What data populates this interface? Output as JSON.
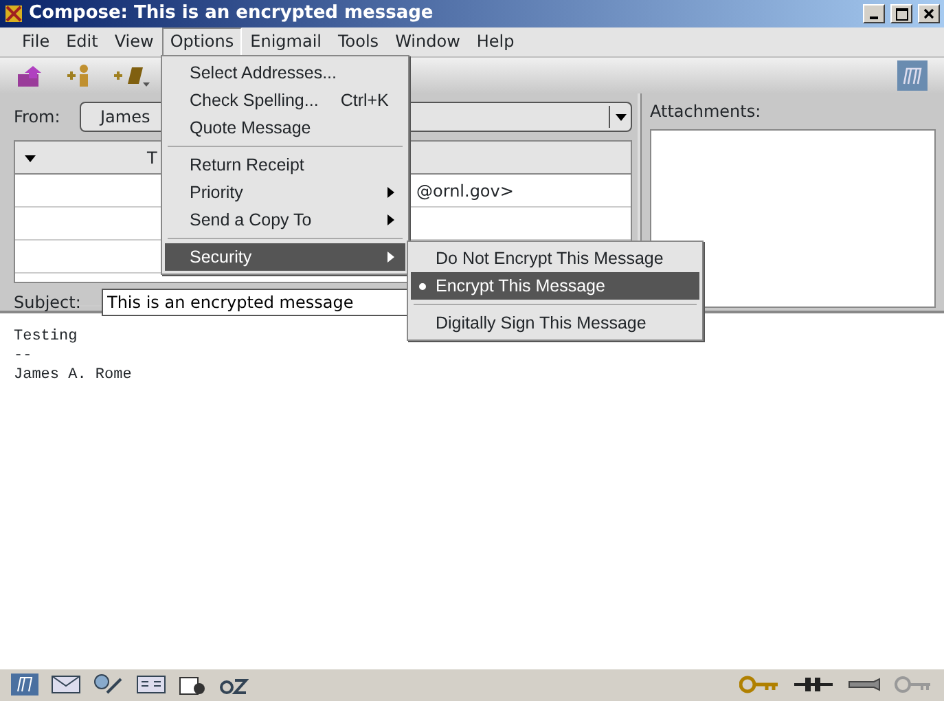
{
  "window": {
    "title": "Compose: This is an encrypted message"
  },
  "menus": [
    {
      "label": "File",
      "selected": false
    },
    {
      "label": "Edit",
      "selected": false
    },
    {
      "label": "View",
      "selected": false
    },
    {
      "label": "Options",
      "selected": true
    },
    {
      "label": "Enigmail",
      "selected": false
    },
    {
      "label": "Tools",
      "selected": false
    },
    {
      "label": "Window",
      "selected": false
    },
    {
      "label": "Help",
      "selected": false
    }
  ],
  "options_menu": {
    "groups": [
      [
        {
          "label": "Select Addresses...",
          "submenu": false,
          "highlighted": false
        },
        {
          "label": "Check Spelling...",
          "shortcut": "Ctrl+K",
          "submenu": false,
          "highlighted": false
        },
        {
          "label": "Quote Message",
          "submenu": false,
          "highlighted": false
        }
      ],
      [
        {
          "label": "Return Receipt",
          "submenu": false,
          "highlighted": false
        },
        {
          "label": "Priority",
          "submenu": true,
          "highlighted": false
        },
        {
          "label": "Send a Copy To",
          "submenu": true,
          "highlighted": false
        }
      ],
      [
        {
          "label": "Security",
          "submenu": true,
          "highlighted": true
        }
      ]
    ]
  },
  "security_menu": {
    "groups": [
      [
        {
          "kind": "radio",
          "label": "Do Not Encrypt This Message",
          "selected": false,
          "highlighted": false
        },
        {
          "kind": "radio",
          "label": "Encrypt This Message",
          "selected": true,
          "highlighted": true
        }
      ],
      [
        {
          "kind": "check",
          "label": "Digitally Sign This Message",
          "checked": false,
          "highlighted": false
        }
      ]
    ]
  },
  "compose": {
    "from_label": "From:",
    "from_value": "James",
    "recipients": {
      "column_2": "T",
      "rows": [
        "@ornl.gov>",
        "",
        "",
        ""
      ]
    },
    "subject_label": "Subject:",
    "subject_value": "This is an encrypted message",
    "attachments_label": "Attachments:"
  },
  "body": [
    "Testing",
    "--",
    "James A. Rome"
  ]
}
